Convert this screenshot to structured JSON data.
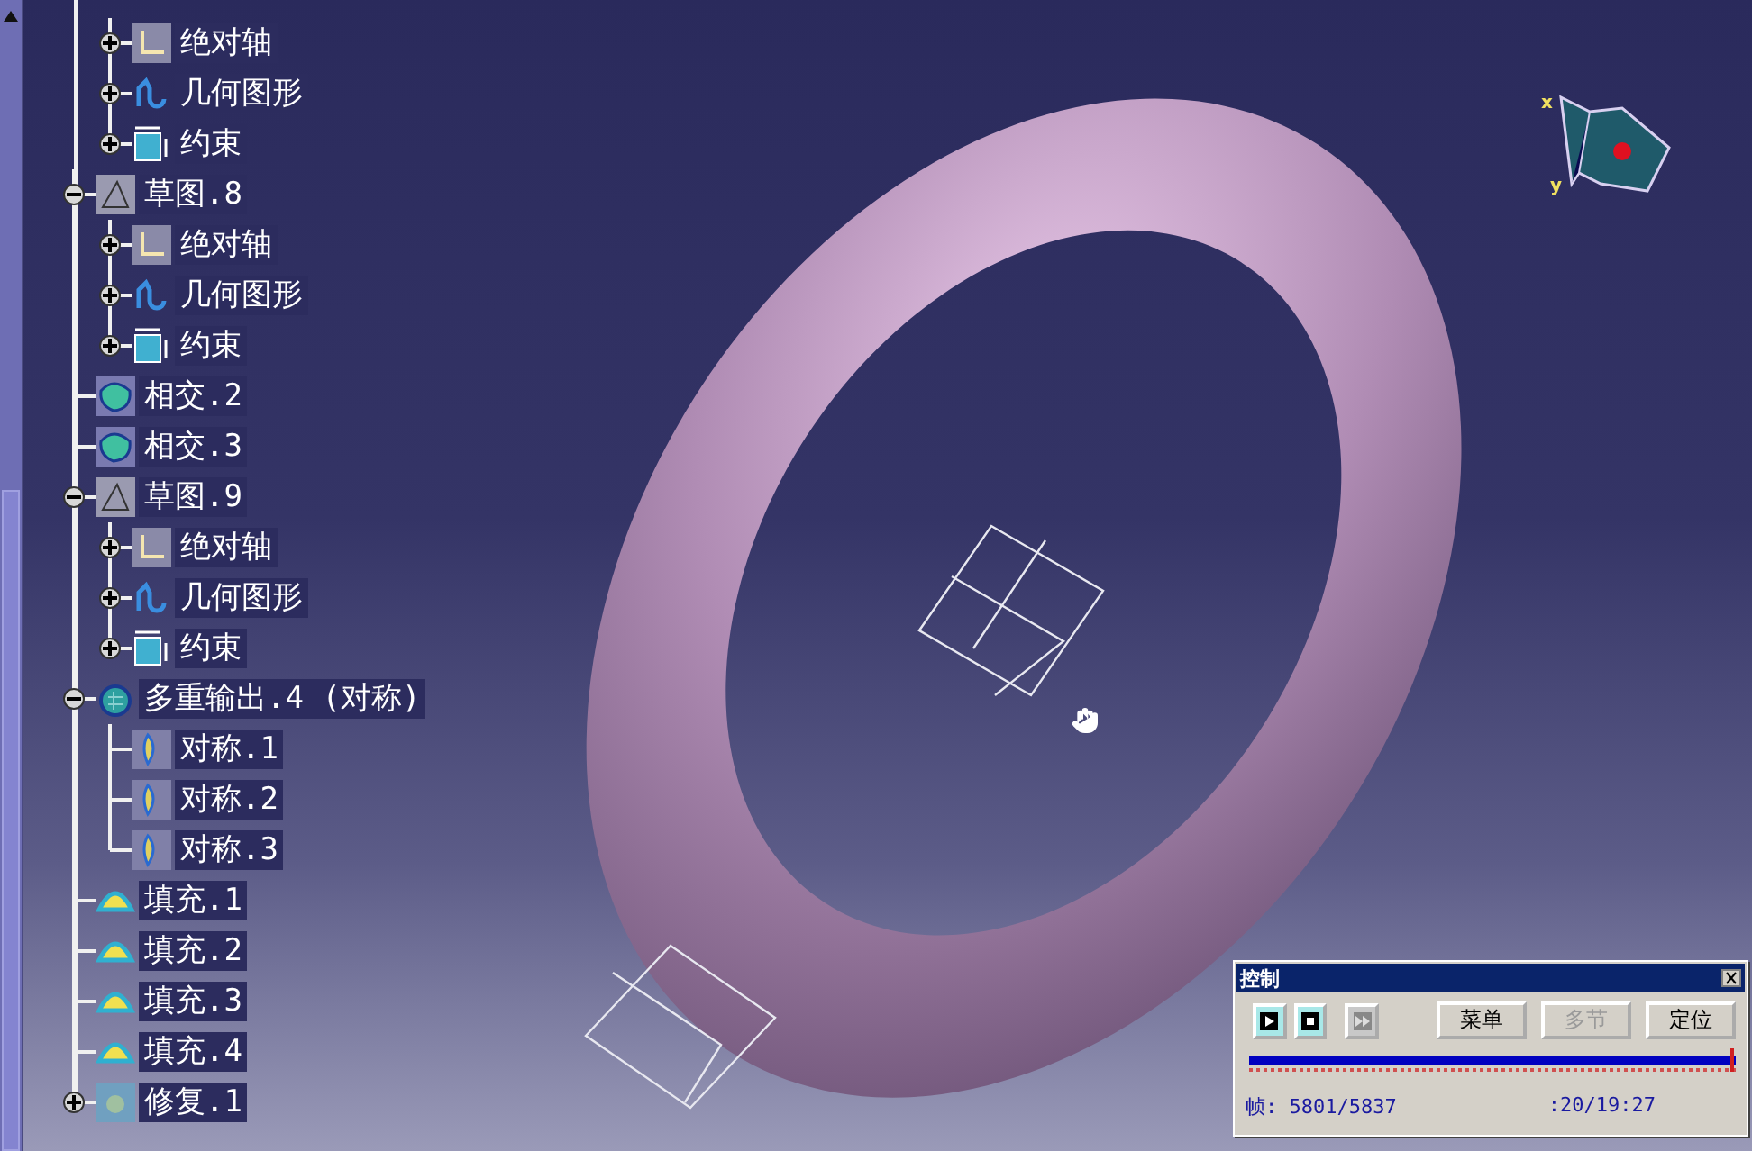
{
  "tree": {
    "leading": [
      {
        "label": "绝对轴",
        "kind": "axis",
        "expanded": false
      },
      {
        "label": "几何图形",
        "kind": "geometry",
        "expanded": false
      },
      {
        "label": "约束",
        "kind": "constraint",
        "expanded": false
      }
    ],
    "items": [
      {
        "label": "草图.8",
        "kind": "sketch",
        "expanded": true,
        "children": [
          {
            "label": "绝对轴",
            "kind": "axis",
            "expanded": false
          },
          {
            "label": "几何图形",
            "kind": "geometry",
            "expanded": false
          },
          {
            "label": "约束",
            "kind": "constraint",
            "expanded": false
          }
        ]
      },
      {
        "label": "相交.2",
        "kind": "intersect"
      },
      {
        "label": "相交.3",
        "kind": "intersect"
      },
      {
        "label": "草图.9",
        "kind": "sketch",
        "expanded": true,
        "children": [
          {
            "label": "绝对轴",
            "kind": "axis",
            "expanded": false
          },
          {
            "label": "几何图形",
            "kind": "geometry",
            "expanded": false
          },
          {
            "label": "约束",
            "kind": "constraint",
            "expanded": false
          }
        ]
      },
      {
        "label": "多重输出.4 (对称)",
        "kind": "multi",
        "expanded": true,
        "children": [
          {
            "label": "对称.1",
            "kind": "symmetry"
          },
          {
            "label": "对称.2",
            "kind": "symmetry"
          },
          {
            "label": "对称.3",
            "kind": "symmetry"
          }
        ]
      },
      {
        "label": "填充.1",
        "kind": "fill"
      },
      {
        "label": "填充.2",
        "kind": "fill"
      },
      {
        "label": "填充.3",
        "kind": "fill"
      },
      {
        "label": "填充.4",
        "kind": "fill"
      },
      {
        "label": "修复.1",
        "kind": "heal",
        "expanded": false
      }
    ]
  },
  "compass": {
    "x_label": "x",
    "y_label": "y"
  },
  "control_panel": {
    "title": "控制",
    "transport": [
      {
        "kind": "play",
        "disabled": false
      },
      {
        "kind": "stop",
        "disabled": false
      },
      {
        "kind": "skip",
        "disabled": true
      }
    ],
    "buttons": [
      {
        "label": "菜单",
        "disabled": false
      },
      {
        "label": "多节",
        "disabled": true
      },
      {
        "label": "定位",
        "disabled": false
      }
    ],
    "timeline": {
      "level": 0.994
    },
    "frame": "帧: 5801/5837",
    "time_fragment": ":20/19:27"
  }
}
